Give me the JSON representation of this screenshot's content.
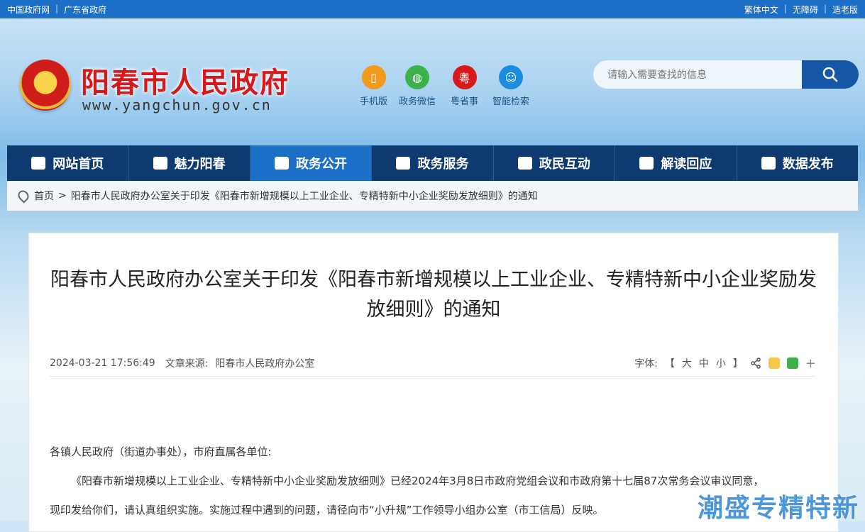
{
  "topbar": {
    "left": [
      "中国政府网",
      "广东省政府"
    ],
    "right": [
      "繁体中文",
      "无障碍",
      "适老版"
    ]
  },
  "header": {
    "title": "阳春市人民政府",
    "url": "www.yangchun.gov.cn",
    "quick": [
      {
        "label": "手机版",
        "icon": "mobile-icon",
        "color": "#f29a1b"
      },
      {
        "label": "政务微信",
        "icon": "wechat-icon",
        "color": "#3db24b"
      },
      {
        "label": "粤省事",
        "icon": "yueshengshi-icon",
        "color": "#d7191c"
      },
      {
        "label": "智能检索",
        "icon": "robot-icon",
        "color": "#1b8ce0"
      }
    ],
    "search_placeholder": "请输入需要查找的信息"
  },
  "nav": [
    {
      "label": "网站首页",
      "icon": "home-icon"
    },
    {
      "label": "魅力阳春",
      "icon": "landscape-icon"
    },
    {
      "label": "政务公开",
      "icon": "document-icon",
      "active": true
    },
    {
      "label": "政务服务",
      "icon": "monitor-icon"
    },
    {
      "label": "政民互动",
      "icon": "people-icon"
    },
    {
      "label": "解读回应",
      "icon": "chat-icon"
    },
    {
      "label": "数据发布",
      "icon": "chart-icon"
    }
  ],
  "breadcrumb": {
    "home": "首页",
    "separator": ">",
    "current": "阳春市人民政府办公室关于印发《阳春市新增规模以上工业企业、专精特新中小企业奖励发放细则》的通知"
  },
  "article": {
    "title": "阳春市人民政府办公室关于印发《阳春市新增规模以上工业企业、专精特新中小企业奖励发放细则》的通知",
    "time": "2024-03-21 17:56:49",
    "source_label": "文章来源:",
    "source": "阳春市人民政府办公室",
    "font_label": "字体:",
    "font_open": "【",
    "font_sizes": [
      "大",
      "中",
      "小"
    ],
    "font_close": "】",
    "share_more": "+",
    "salutation": "各镇人民政府（街道办事处），市府直属各单位:",
    "paragraph1": "《阳春市新增规模以上工业企业、专精特新中小企业奖励发放细则》已经2024年3月8日市政府党组会议和市政府第十七届87次常务会议审议同意，",
    "paragraph2": "现印发给你们，请认真组织实施。实施过程中遇到的问题，请径向市“小升规”工作领导小组办公室（市工信局）反映。"
  },
  "watermark": "潮盛专精特新"
}
